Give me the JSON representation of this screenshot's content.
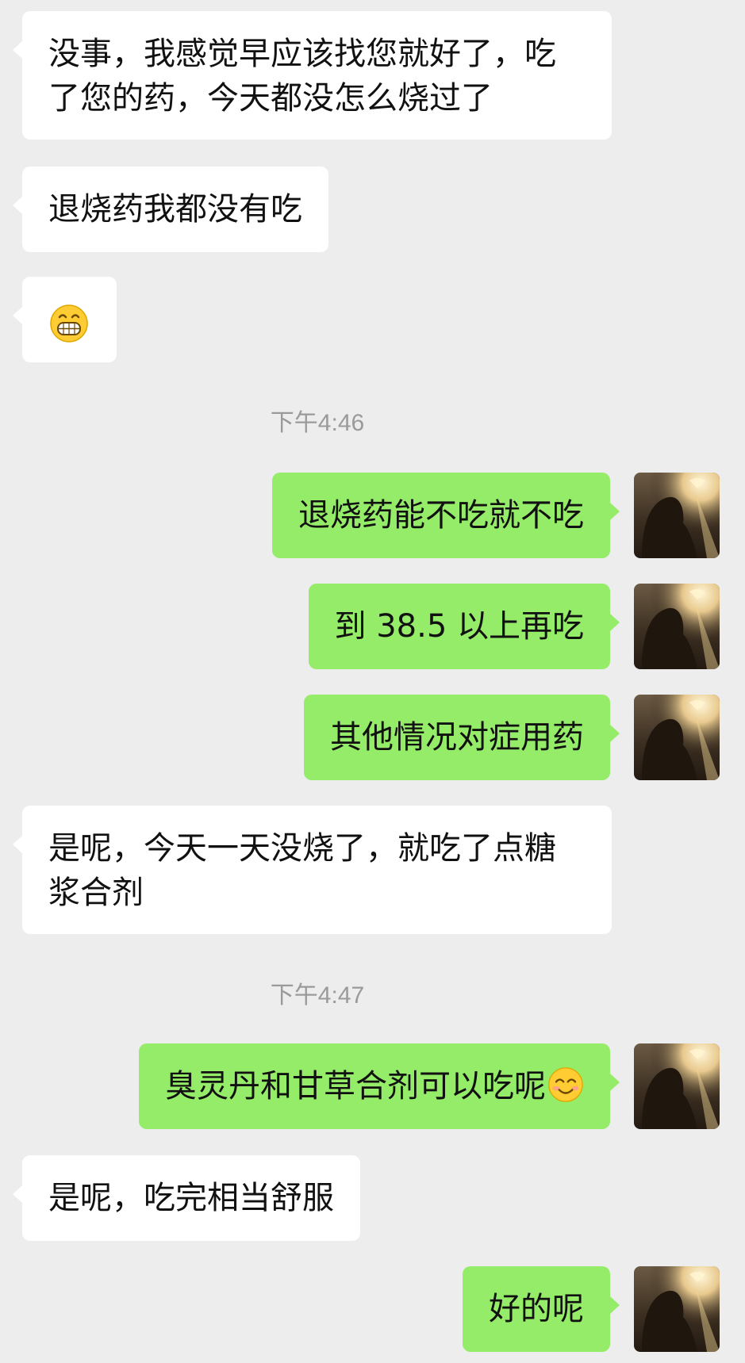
{
  "messages": [
    {
      "side": "received",
      "text": "没事，我感觉早应该找您就好了，吃了您的药，今天都没怎么烧过了"
    },
    {
      "side": "received",
      "text": "退烧药我都没有吃"
    },
    {
      "side": "received",
      "emoji": "grinning-face-emoji"
    },
    {
      "type": "time",
      "text": "下午4:46"
    },
    {
      "side": "sent",
      "text": "退烧药能不吃就不吃"
    },
    {
      "side": "sent",
      "text": "到 38.5 以上再吃"
    },
    {
      "side": "sent",
      "text": "其他情况对症用药"
    },
    {
      "side": "received",
      "text": "是呢，今天一天没烧了，就吃了点糖浆合剂"
    },
    {
      "type": "time",
      "text": "下午4:47"
    },
    {
      "side": "sent",
      "text": "臭灵丹和甘草合剂可以吃呢",
      "emoji": "smiling-face-emoji"
    },
    {
      "side": "received",
      "text": "是呢，吃完相当舒服"
    },
    {
      "side": "sent",
      "text": "好的呢"
    }
  ],
  "colors": {
    "background": "#ededed",
    "received_bubble": "#ffffff",
    "sent_bubble": "#95ec69",
    "timestamp_text": "#9a9a9a"
  },
  "avatar": {
    "icon": "user-avatar-image"
  }
}
